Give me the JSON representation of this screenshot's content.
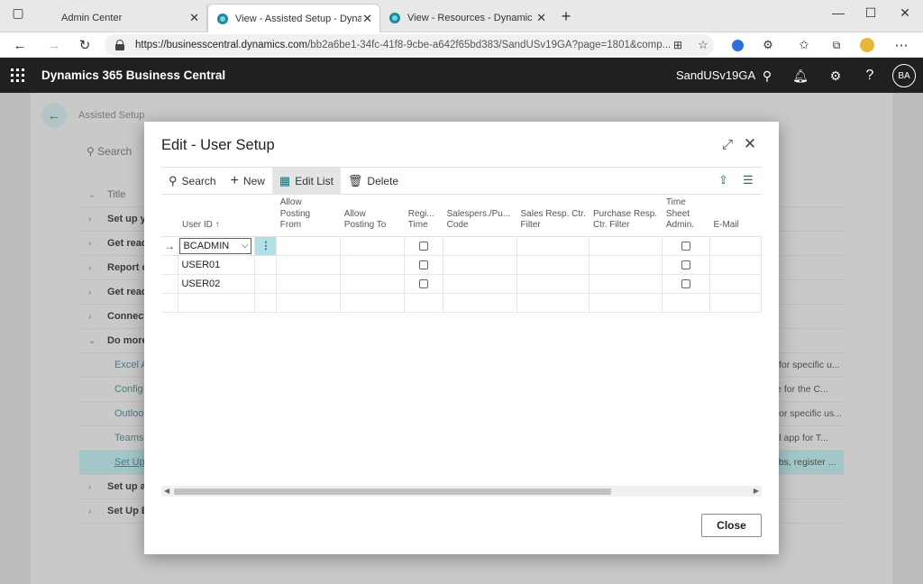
{
  "browser": {
    "tabs": [
      {
        "label": "Admin Center"
      },
      {
        "label": "View - Assisted Setup - Dynamic"
      },
      {
        "label": "View - Resources - Dynamics 365"
      }
    ],
    "url_host": "https://businesscentral.dynamics.com",
    "url_path": "/bb2a6be1-34fc-41f8-9cbe-a642f65bd383/SandUSv19GA?page=1801&comp..."
  },
  "app": {
    "name": "Dynamics 365 Business Central",
    "environment": "SandUSv19GA",
    "avatar_initials": "BA"
  },
  "background_page": {
    "breadcrumb": "Assisted Setup",
    "search_label": "Search",
    "column_title": "Title",
    "rows": [
      {
        "title": "Set up y",
        "desc": ""
      },
      {
        "title": "Get read",
        "desc": ""
      },
      {
        "title": "Report c",
        "desc": ""
      },
      {
        "title": "Get read",
        "desc": ""
      },
      {
        "title": "Connect",
        "desc": ""
      },
      {
        "title": "Do more",
        "desc": ""
      },
      {
        "title": "Excel A",
        "desc": "for specific u..."
      },
      {
        "title": "Config",
        "desc": "ase for the C..."
      },
      {
        "title": "Outloo",
        "desc": "or specific us..."
      },
      {
        "title": "Teams",
        "desc": "tral app for T..."
      },
      {
        "title": "Set Up",
        "desc": "obs, register ..."
      },
      {
        "title": "Set up a",
        "desc": ""
      },
      {
        "title": "Set Up E",
        "desc": ""
      }
    ]
  },
  "dialog": {
    "title": "Edit - User Setup",
    "toolbar": {
      "search": "Search",
      "new": "New",
      "edit_list": "Edit List",
      "delete": "Delete"
    },
    "columns": {
      "user_id": "User ID ↑",
      "allow_from": [
        "Allow",
        "Posting",
        "From"
      ],
      "allow_to": [
        "Allow",
        "Posting To"
      ],
      "register_time": [
        "Regi...",
        "Time"
      ],
      "salespers": [
        "Salespers./Pu...",
        "Code"
      ],
      "sales_resp": [
        "Sales Resp. Ctr.",
        "Filter"
      ],
      "purchase_resp": [
        "Purchase Resp.",
        "Ctr. Filter"
      ],
      "time_sheet": [
        "Time",
        "Sheet",
        "Admin."
      ],
      "email": "E-Mail"
    },
    "rows": [
      {
        "user_id": "BCADMIN",
        "register_time": false,
        "time_sheet_admin": false
      },
      {
        "user_id": "USER01",
        "register_time": false,
        "time_sheet_admin": false
      },
      {
        "user_id": "USER02",
        "register_time": false,
        "time_sheet_admin": false
      }
    ],
    "close_label": "Close"
  }
}
